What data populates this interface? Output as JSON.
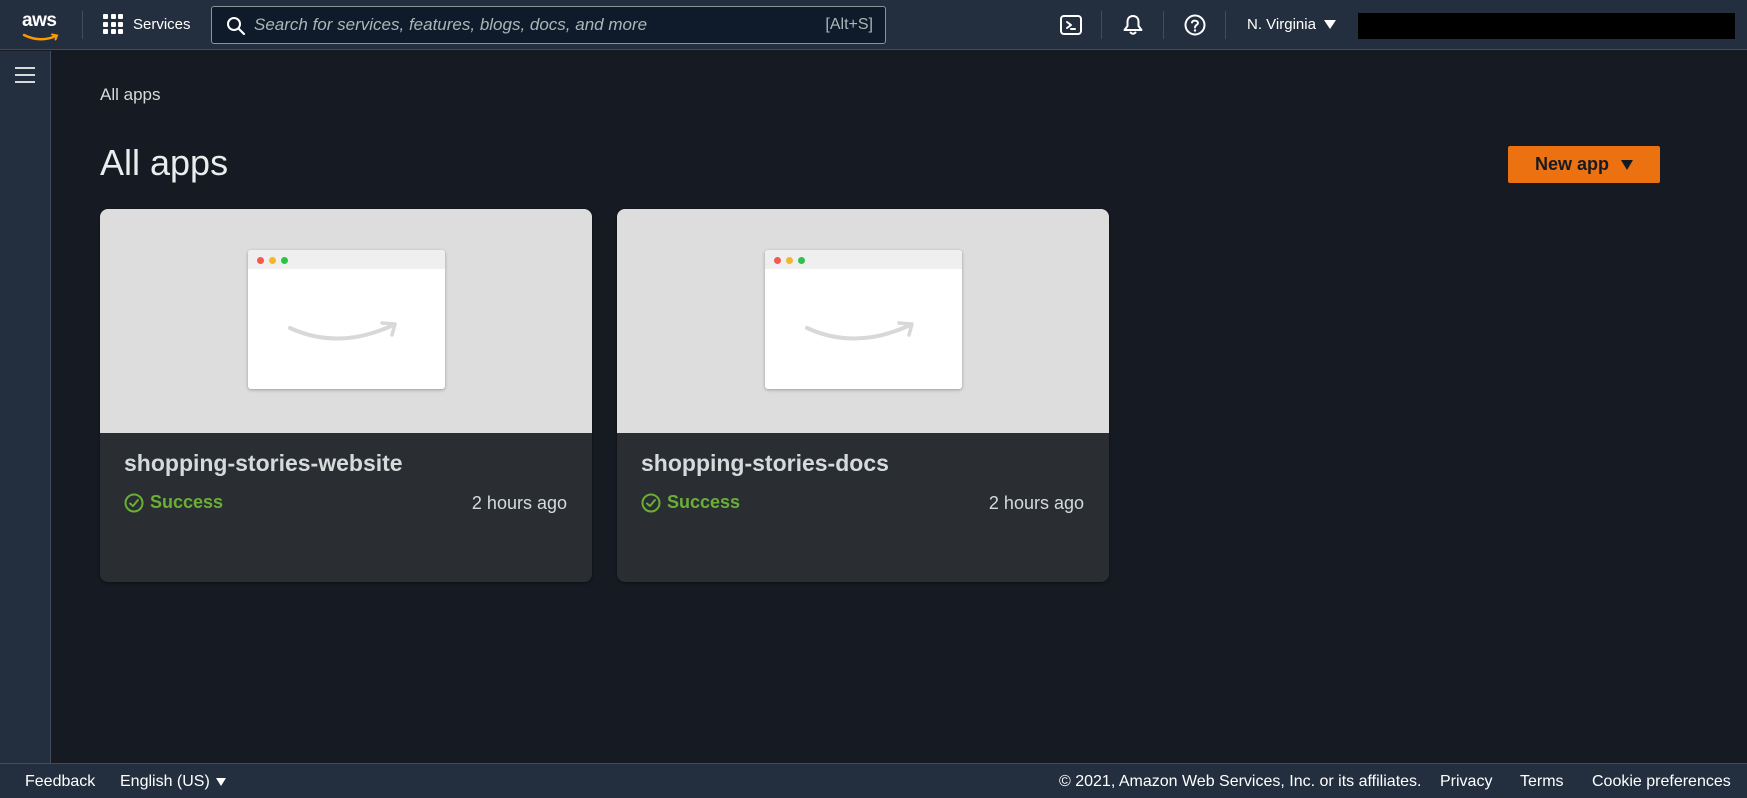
{
  "topnav": {
    "logo_text": "aws",
    "services_label": "Services",
    "search_placeholder": "Search for services, features, blogs, docs, and more",
    "search_shortcut": "[Alt+S]",
    "region_label": "N. Virginia",
    "icons": [
      "cloudshell-icon",
      "bell-icon",
      "help-icon"
    ]
  },
  "breadcrumb": "All apps",
  "page_title": "All apps",
  "new_app_label": "New app",
  "apps": [
    {
      "name": "shopping-stories-website",
      "status": "Success",
      "time": "2 hours ago"
    },
    {
      "name": "shopping-stories-docs",
      "status": "Success",
      "time": "2 hours ago"
    }
  ],
  "colors": {
    "accent": "#ec7211",
    "success": "#6aaf35",
    "nav_bg": "#232f3e",
    "page_bg": "#161a22"
  },
  "footer": {
    "feedback": "Feedback",
    "language": "English (US)",
    "copyright": "© 2021, Amazon Web Services, Inc. or its affiliates.",
    "privacy": "Privacy",
    "terms": "Terms",
    "cookies": "Cookie preferences"
  }
}
